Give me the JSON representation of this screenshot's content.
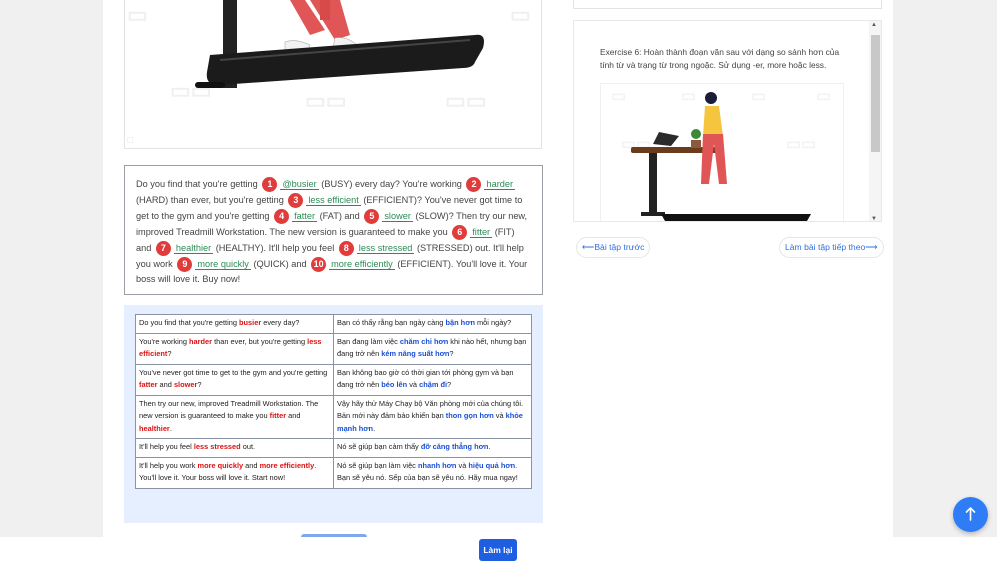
{
  "exercise_passage": {
    "s1": "Do you find that you're getting",
    "n1": "1",
    "a1": "@busier",
    "h1": "(BUSY) every day? You're working",
    "n2": "2",
    "a2": "harder",
    "h2": "(HARD) than ever, but you're getting",
    "n3": "3",
    "a3": "less efficient",
    "h3": "(EFFICIENT)? You've never got time to get to the gym and you're getting",
    "n4": "4",
    "a4": "fatter",
    "h4": "(FAT) and",
    "n5": "5",
    "a5": "slower",
    "h5": "(SLOW)? Then try our new, improved Treadmill Workstation. The new version is guaranteed to make you",
    "n6": "6",
    "a6": "fitter",
    "h6": "(FIT) and",
    "n7": "7",
    "a7": "healthier",
    "h7": "(HEALTHY). It'll help you feel",
    "n8": "8",
    "a8": "less stressed",
    "h8": "(STRESSED) out. It'll help you work",
    "n9": "9",
    "a9": "more quickly",
    "h9": "(QUICK) and",
    "n10": "10",
    "a10": "more efficiently",
    "h10": "(EFFICIENT). You'll love it. Your boss will love it. Buy now!"
  },
  "translation_table": {
    "r1": {
      "en1": "Do you find that you're getting ",
      "enr1": "busier",
      "en2": " every day?",
      "vi1": "Bạn có thấy rằng bạn ngày càng ",
      "vib1": "bận hơn",
      "vi2": " mỗi ngày?"
    },
    "r2": {
      "en1": "You're working ",
      "enr1": "harder",
      "en2": " than ever, but you're getting ",
      "enr2": "less efficient",
      "en3": "?",
      "vi1": "Bạn đang làm việc ",
      "vib1": "chăm chỉ hơn",
      "vi2": " khi nào hết, nhưng bạn đang trở nên ",
      "vib2": "kém năng suất hơn",
      "vi3": "?"
    },
    "r3": {
      "en1": "You've never got time to get to the gym and you're getting ",
      "enr1": "fatter",
      "en2": " and ",
      "enr2": "slower",
      "en3": "?",
      "vi1": "Bạn không bao giờ có thời gian tới phòng gym và bạn đang trở nên ",
      "vib1": "béo lên",
      "vi2": " và ",
      "vib2": "chậm đi",
      "vi3": "?"
    },
    "r4": {
      "en1": "Then try our new, improved Treadmill Workstation. The new version is guaranteed to make you ",
      "enr1": "fitter",
      "en2": " and ",
      "enr2": "healthier",
      "en3": ".",
      "vi1": "Vậy hãy thử Máy Chạy bộ Văn phòng mới của chúng tôi. Bản mới này đảm bảo khiến bạn ",
      "vib1": "thon gọn hơn",
      "vi2": " và ",
      "vib2": "khỏe mạnh hơn",
      "vi3": "."
    },
    "r5": {
      "en1": "It'll help you feel ",
      "enr1": "less stressed",
      "en2": " out.",
      "vi1": "Nó sẽ giúp bạn cảm thấy ",
      "vib1": "đỡ căng thẳng hơn",
      "vi2": "."
    },
    "r6": {
      "en1": "It'll help you work ",
      "enr1": "more quickly",
      "en2": " and ",
      "enr2": "more efficiently",
      "en3": ". You'll love it. Your boss will love it. Start now!",
      "vi1": "Nó sẽ giúp bạn làm việc ",
      "vib1": "nhanh hơn",
      "vi2": " và ",
      "vib2": "hiệu quả hơn",
      "vi3": ". Bạn sẽ yêu nó. Sếp của bạn sẽ yêu nó. Hãy mua ngay!"
    }
  },
  "right_panel": {
    "exercise6_text": "Exercise 6: Hoàn thành đoạn văn sau với dạng so sánh hơn của tính từ và trạng từ trong ngoặc. Sử dụng -er, more hoặc less.",
    "prev_label": "Bài tập trước",
    "next_label": "Làm bài tập tiếp theo",
    "prev_arrow": "⟵",
    "next_arrow": "⟶"
  },
  "bottom_bar": {
    "retry_label": "Làm lại"
  },
  "icons": {
    "fab": "arrow-up-icon",
    "scroll_up": "triangle-up-icon",
    "scroll_down": "triangle-down-icon"
  },
  "colors": {
    "accent": "#1d5fe0",
    "answer": "#2e8b57",
    "number_badge": "#e03c3c",
    "highlight_red": "#dd1111",
    "highlight_blue": "#1a4fd6",
    "table_bg": "#e6efff"
  }
}
